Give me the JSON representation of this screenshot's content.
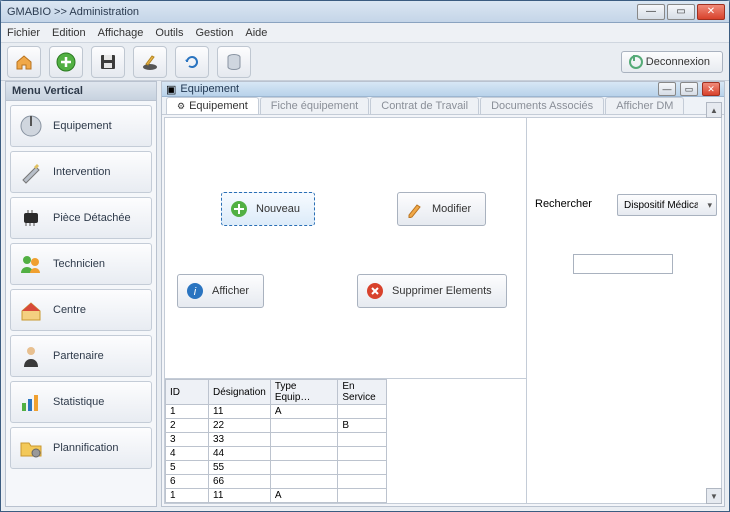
{
  "window": {
    "title": "GMABIO >> Administration"
  },
  "menu": {
    "items": [
      "Fichier",
      "Edition",
      "Affichage",
      "Outils",
      "Gestion",
      "Aide"
    ]
  },
  "toolbar": {
    "deconnexion_label": "Deconnexion"
  },
  "sidebar": {
    "title": "Menu Vertical",
    "items": [
      {
        "label": "Equipement"
      },
      {
        "label": "Intervention"
      },
      {
        "label": "Pièce Détachée"
      },
      {
        "label": "Technicien"
      },
      {
        "label": "Centre"
      },
      {
        "label": "Partenaire"
      },
      {
        "label": "Statistique"
      },
      {
        "label": "Plannification"
      }
    ]
  },
  "inner": {
    "title": "Equipement",
    "tabs": [
      {
        "label": "Equipement"
      },
      {
        "label": "Fiche équipement"
      },
      {
        "label": "Contrat de Travail"
      },
      {
        "label": "Documents Associés"
      },
      {
        "label": "Afficher DM"
      }
    ]
  },
  "buttons": {
    "nouveau": "Nouveau",
    "modifier": "Modifier",
    "afficher": "Afficher",
    "supprimer": "Supprimer Elements"
  },
  "search": {
    "label": "Rechercher",
    "combo_value": "Dispositif Médical",
    "input_value": ""
  },
  "table": {
    "headers": [
      "ID",
      "Désignation",
      "Type Equip…",
      "En Service"
    ],
    "rows": [
      [
        "1",
        "11",
        "A",
        ""
      ],
      [
        "2",
        "22",
        "",
        "B"
      ],
      [
        "3",
        "33",
        "",
        ""
      ],
      [
        "4",
        "44",
        "",
        ""
      ],
      [
        "5",
        "55",
        "",
        ""
      ],
      [
        "6",
        "66",
        "",
        ""
      ],
      [
        "1",
        "11",
        "A",
        ""
      ]
    ]
  }
}
